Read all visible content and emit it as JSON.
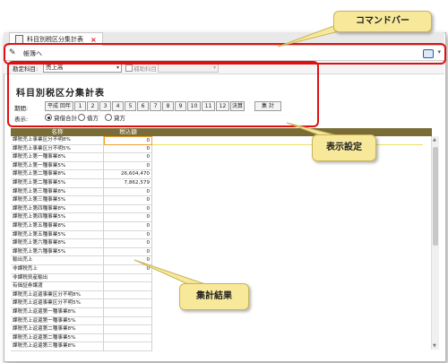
{
  "tab": {
    "title": "科目別税区分集計表",
    "close": "×"
  },
  "toolbar": {
    "edit_label": "帳簿へ",
    "edit_icon": "pencil-icon",
    "printer_icon": "printer-icon",
    "caret": "▾"
  },
  "filter": {
    "account_label": "勘定科目:",
    "account_value": "売上高",
    "sub_label": "補助科目",
    "sub_value": ""
  },
  "report": {
    "title": "科目別税区分集計表",
    "period_label": "期間:",
    "period_buttons": [
      "平成 回年",
      "1",
      "2",
      "3",
      "4",
      "5",
      "6",
      "7",
      "8",
      "9",
      "10",
      "11",
      "12",
      "決算"
    ],
    "aggregate_button": "集 計",
    "display_label": "表示:",
    "display_options": [
      "貸借合計",
      "借方",
      "貸方"
    ],
    "display_selected": 0
  },
  "grid": {
    "headers": [
      "名称",
      "税込額"
    ],
    "rows": [
      {
        "name": "課税売上事業区分不明8%",
        "value": "0"
      },
      {
        "name": "課税売上事業区分不明5%",
        "value": "0"
      },
      {
        "name": "課税売上第一種事業8%",
        "value": "0"
      },
      {
        "name": "課税売上第一種事業5%",
        "value": "0"
      },
      {
        "name": "課税売上第二種事業8%",
        "value": "26,604,470"
      },
      {
        "name": "課税売上第二種事業5%",
        "value": "7,862,579"
      },
      {
        "name": "課税売上第三種事業8%",
        "value": "0"
      },
      {
        "name": "課税売上第三種事業5%",
        "value": "0"
      },
      {
        "name": "課税売上第四種事業8%",
        "value": "0"
      },
      {
        "name": "課税売上第四種事業5%",
        "value": "0"
      },
      {
        "name": "課税売上第五種事業8%",
        "value": "0"
      },
      {
        "name": "課税売上第五種事業5%",
        "value": "0"
      },
      {
        "name": "課税売上第六種事業8%",
        "value": "0"
      },
      {
        "name": "課税売上第六種事業5%",
        "value": "0"
      },
      {
        "name": "輸出売上",
        "value": "0"
      },
      {
        "name": "非課税売上",
        "value": "0"
      },
      {
        "name": "非課税資産輸出",
        "value": ""
      },
      {
        "name": "有価証券譲渡",
        "value": ""
      },
      {
        "name": "課税売上返還事業区分不明8%",
        "value": ""
      },
      {
        "name": "課税売上返還事業区分不明5%",
        "value": ""
      },
      {
        "name": "課税売上返還第一種事業8%",
        "value": ""
      },
      {
        "name": "課税売上返還第一種事業5%",
        "value": ""
      },
      {
        "name": "課税売上返還第二種事業8%",
        "value": ""
      },
      {
        "name": "課税売上返還第二種事業5%",
        "value": ""
      },
      {
        "name": "課税売上返還第三種事業8%",
        "value": ""
      }
    ]
  },
  "callouts": {
    "command_bar": "コマンドバー",
    "display_settings": "表示設定",
    "result": "集計結果"
  },
  "colors": {
    "header_bg": "#7a6c36",
    "callout_border": "#e01010",
    "bubble_bg": "#f7e89a"
  }
}
